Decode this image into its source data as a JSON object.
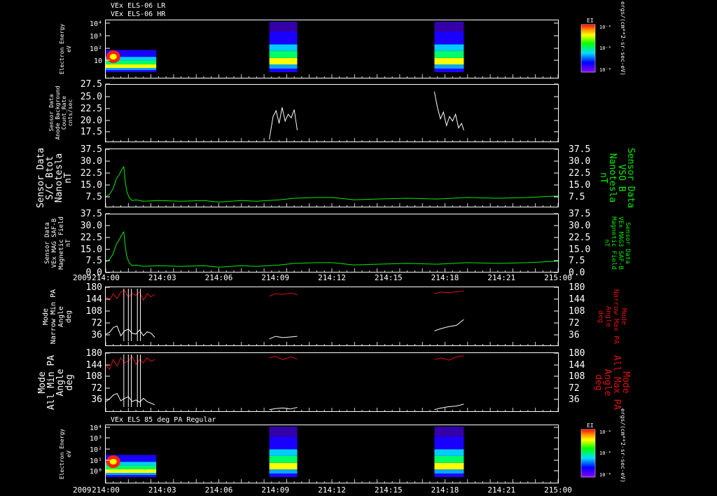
{
  "colors": {
    "white": "#ffffff",
    "green": "#00ee00",
    "red": "#dd1111",
    "background": "#000000"
  },
  "header": {
    "line1": "VEx ELS-06 LR",
    "line2": "VEx ELS-06 HR",
    "bottom_title": "VEx ELS 85 deg PA Regular"
  },
  "time_axis": {
    "year": "2009",
    "ticks": [
      "214:00",
      "214:03",
      "214:06",
      "214:09",
      "214:12",
      "214:15",
      "214:18",
      "214:21",
      "215:00"
    ],
    "x_range_minutes": [
      0,
      60
    ]
  },
  "colorbar": {
    "title": "EI",
    "units": "ergs/(cm**2-sr-sec-eV)",
    "tick_labels": [
      "10⁻⁴",
      "10⁻⁶",
      "10⁻⁸"
    ]
  },
  "panels": [
    {
      "id": "spec1",
      "ylabel": [
        "Electron Energy",
        "eV"
      ],
      "ytick_labels": [
        "10⁴",
        "10³",
        "10²",
        "10"
      ]
    },
    {
      "id": "bkg",
      "ylabel": [
        "Sensor Data",
        "Anode Background",
        "Count_Rate",
        "cnts/sec"
      ],
      "ytick_labels": [
        "27.5",
        "25.0",
        "22.5",
        "20.0",
        "17.5"
      ]
    },
    {
      "id": "bvso",
      "ylabel": [
        "Sensor Data",
        "S/C Btot",
        "Nanotesla",
        "nT"
      ],
      "ytick_labels": [
        "37.5",
        "30.0",
        "22.5",
        "15.0",
        "7.5"
      ],
      "right_label": [
        "Sensor Data",
        "VSO B",
        "Nanotesla",
        "nT"
      ],
      "rtick_labels": [
        "37.5",
        "30.0",
        "22.5",
        "15.0",
        "7.5"
      ]
    },
    {
      "id": "bsaf",
      "ylabel": [
        "Sensor Data",
        "VEx MAG SAF-B",
        "Magnetic Field",
        "nT"
      ],
      "ytick_labels": [
        "37.5",
        "30.0",
        "22.5",
        "15.0",
        "7.5",
        "0.0"
      ],
      "right_label": [
        "Sensor Data",
        "VEx MAG3 SAF-B",
        "Magnetic Field",
        "nT"
      ],
      "rtick_labels": [
        "37.5",
        "30.0",
        "22.5",
        "15.0",
        "7.5",
        "0.0"
      ]
    },
    {
      "id": "pa_narrow",
      "ylabel": [
        "Mode",
        "Narrow Min PA",
        "Angle",
        "deg"
      ],
      "ytick_labels": [
        "180",
        "144",
        "108",
        "72",
        "36"
      ],
      "right_label": [
        "Mode",
        "Narrow Max PA",
        "Angle",
        "deg"
      ],
      "rtick_labels": [
        "180",
        "144",
        "108",
        "72",
        "36"
      ]
    },
    {
      "id": "pa_all",
      "ylabel": [
        "Mode",
        "All Min PA",
        "Angle",
        "deg"
      ],
      "ytick_labels": [
        "180",
        "144",
        "108",
        "72",
        "36"
      ],
      "right_label": [
        "Mode",
        "All Max PA",
        "Angle",
        "deg"
      ],
      "rtick_labels": [
        "180",
        "144",
        "108",
        "72",
        "36"
      ]
    },
    {
      "id": "spec2",
      "ylabel": [
        "Electron Energy",
        "eV"
      ],
      "ytick_labels": [
        "10⁴",
        "10³",
        "10²",
        "10¹",
        "10⁰"
      ]
    }
  ],
  "chart_data": [
    {
      "type": "heatmap",
      "panel": "spec1",
      "ylabel": "Electron Energy eV",
      "data_intervals_min": [
        [
          0.0,
          6.7
        ],
        [
          21.7,
          25.4
        ],
        [
          43.6,
          47.5
        ]
      ]
    },
    {
      "type": "line",
      "panel": "bkg",
      "ylabel": "Anode Background Count_Rate cnts/sec",
      "ylim": [
        15.0,
        27.5
      ],
      "series": [
        {
          "x": [
            21.7,
            22.2,
            22.6,
            23.0,
            23.4,
            23.8,
            24.2,
            24.6,
            25.0,
            25.4
          ],
          "y": [
            15.5,
            20.5,
            21.8,
            19.0,
            22.5,
            19.5,
            21.0,
            20.2,
            22.0,
            17.5
          ]
        },
        {
          "x": [
            43.6,
            44.0,
            44.4,
            44.8,
            45.2,
            45.6,
            46.0,
            46.4,
            46.8,
            47.2,
            47.5
          ],
          "y": [
            26.0,
            22.5,
            20.0,
            21.5,
            18.5,
            20.5,
            19.5,
            21.0,
            18.0,
            19.0,
            17.5
          ]
        }
      ]
    },
    {
      "type": "line",
      "panel": "bvso",
      "ylabel": "S/C Btot Nanotesla nT",
      "ylim": [
        0,
        37.5
      ],
      "series": [
        {
          "name": "VSO B",
          "x": [
            0,
            0.5,
            1,
            1.4,
            1.8,
            2.1,
            2.4,
            2.6,
            2.8,
            3.1,
            3.5,
            4,
            5,
            7,
            10,
            13,
            15,
            18,
            20,
            23,
            25,
            28,
            30,
            33,
            36,
            40,
            44,
            48,
            52,
            56,
            60
          ],
          "y": [
            6.5,
            8,
            12,
            18,
            21,
            24,
            26,
            16,
            10,
            6,
            4,
            4.5,
            3.5,
            4,
            3.5,
            4,
            3,
            4,
            3.5,
            4.5,
            5.5,
            6,
            6,
            4.5,
            5,
            5.5,
            5,
            6,
            5.5,
            6,
            7
          ]
        }
      ]
    },
    {
      "type": "line",
      "panel": "bsaf",
      "ylabel": "VEx MAG SAF-B Magnetic Field nT",
      "ylim": [
        0,
        37.5
      ],
      "series": [
        {
          "name": "MAG3 SAF-B",
          "x": [
            0,
            0.5,
            1,
            1.4,
            1.8,
            2.1,
            2.4,
            2.6,
            2.8,
            3.1,
            3.5,
            4,
            5,
            7,
            10,
            13,
            15,
            18,
            20,
            23,
            25,
            28,
            30,
            33,
            36,
            40,
            44,
            48,
            52,
            56,
            60
          ],
          "y": [
            6.5,
            8,
            12,
            18,
            21,
            24,
            26,
            16,
            10,
            6,
            4,
            4.5,
            3.5,
            4,
            3.5,
            4,
            3,
            4,
            3.5,
            4.5,
            5.5,
            6,
            6,
            4.5,
            5,
            5.5,
            5,
            6,
            5.5,
            6,
            7
          ]
        }
      ]
    },
    {
      "type": "line",
      "panel": "pa_narrow",
      "ylabel": "Narrow Min PA Angle deg",
      "ylim": [
        0,
        180
      ],
      "series": [
        {
          "name": "Narrow Min PA",
          "x": [
            0.0,
            0.5,
            1.0,
            1.5,
            2.0,
            2.5,
            3.0,
            3.5,
            4.0,
            4.5,
            5.0,
            5.5,
            6.0,
            6.5,
            21.7,
            22.5,
            23.5,
            24.5,
            25.4,
            43.6,
            44.5,
            45.5,
            46.5,
            47.5
          ],
          "y": [
            35,
            40,
            55,
            60,
            30,
            45,
            50,
            38,
            35,
            48,
            30,
            42,
            38,
            25,
            20,
            28,
            24,
            26,
            28,
            45,
            52,
            58,
            62,
            80
          ]
        },
        {
          "name": "Narrow Max PA",
          "x": [
            0.0,
            0.5,
            1.0,
            1.5,
            2.0,
            2.5,
            3.0,
            3.5,
            4.0,
            4.5,
            5.0,
            5.5,
            6.0,
            6.5,
            21.7,
            22.5,
            23.5,
            24.5,
            25.4,
            43.6,
            44.5,
            45.5,
            46.5,
            47.5
          ],
          "y": [
            150,
            140,
            160,
            145,
            165,
            170,
            150,
            160,
            155,
            165,
            140,
            160,
            150,
            158,
            152,
            160,
            158,
            162,
            157,
            160,
            165,
            163,
            166,
            168
          ]
        }
      ]
    },
    {
      "type": "line",
      "panel": "pa_all",
      "ylabel": "All Min PA Angle deg",
      "ylim": [
        0,
        180
      ],
      "series": [
        {
          "name": "All Min PA",
          "x": [
            0.0,
            0.5,
            1.0,
            1.5,
            2.0,
            2.5,
            3.0,
            3.5,
            4.0,
            4.5,
            5.0,
            5.5,
            6.0,
            6.5,
            21.7,
            22.5,
            23.5,
            24.5,
            25.4,
            43.6,
            44.5,
            45.5,
            46.5,
            47.5
          ],
          "y": [
            30,
            38,
            50,
            55,
            32,
            40,
            45,
            30,
            35,
            28,
            40,
            30,
            25,
            20,
            5,
            8,
            10,
            7,
            12,
            5,
            10,
            14,
            16,
            22
          ]
        },
        {
          "name": "All Max PA",
          "x": [
            0.0,
            0.5,
            1.0,
            1.5,
            2.0,
            2.5,
            3.0,
            3.5,
            4.0,
            4.5,
            5.0,
            5.5,
            6.0,
            6.5,
            21.7,
            22.5,
            23.5,
            24.5,
            25.4,
            43.6,
            44.5,
            45.5,
            46.5,
            47.5
          ],
          "y": [
            145,
            130,
            160,
            140,
            165,
            150,
            155,
            170,
            145,
            160,
            150,
            165,
            155,
            160,
            165,
            170,
            160,
            168,
            162,
            160,
            165,
            158,
            168,
            172
          ]
        }
      ]
    },
    {
      "type": "heatmap",
      "panel": "spec2",
      "ylabel": "Electron Energy eV",
      "data_intervals_min": [
        [
          0.0,
          6.7
        ],
        [
          21.7,
          25.4
        ],
        [
          43.6,
          47.5
        ]
      ]
    }
  ]
}
